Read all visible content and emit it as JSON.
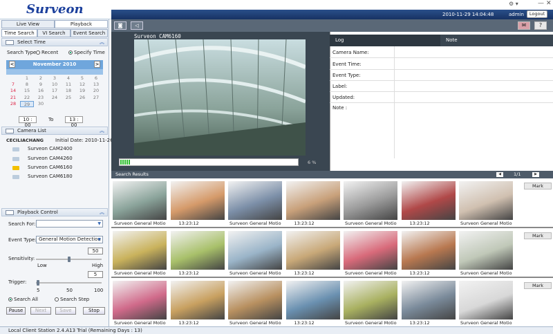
{
  "app": {
    "logo": "Surveon",
    "datetime": "2010-11-29 14:04:48",
    "user": "admin",
    "logout": "Logout",
    "window_controls": "⚙ ▾",
    "min": "—",
    "close": "✕"
  },
  "main_tabs": [
    "Live View",
    "Playback"
  ],
  "sub_tabs": [
    "Time Search",
    "VI Search",
    "Event Search"
  ],
  "select_time": {
    "title": "Select Time",
    "search_type_label": "Search Type:",
    "opt_recent": "Recent",
    "opt_specify": "Specify Time",
    "month": "November 2010",
    "prev": "<",
    "next": ">",
    "weeks": [
      [
        "",
        "1",
        "2",
        "3",
        "4",
        "5",
        "6"
      ],
      [
        "7",
        "8",
        "9",
        "10",
        "11",
        "12",
        "13"
      ],
      [
        "14",
        "15",
        "16",
        "17",
        "18",
        "19",
        "20"
      ],
      [
        "21",
        "22",
        "23",
        "24",
        "25",
        "26",
        "27"
      ],
      [
        "28",
        "29",
        "30",
        "",
        "",
        "",
        ""
      ]
    ],
    "from_time": "10 : 00",
    "to_label": "To",
    "to_time": "13 : 00"
  },
  "camera_list": {
    "title": "Camera List",
    "group": "CECILIACHANG",
    "initial_date": "Initial Date: 2010-11-26",
    "cameras": [
      "Surveon CAM2400",
      "Surveon CAM4260",
      "Surveon CAM6160",
      "Surveon CAM6180"
    ]
  },
  "playback_control": {
    "title": "Playback Control",
    "search_for_label": "Search For:",
    "search_for_value": "",
    "event_type_label": "Event Type:",
    "event_type_value": "General Motion Detection",
    "sensitivity_label": "Sensitivity:",
    "sens_value": "50",
    "low": "Low",
    "high": "High",
    "sens_step": "5",
    "trigger_label": "Trigger:",
    "trig_min": "5",
    "trig_mid": "50",
    "trig_max": "100",
    "search_all": "Search All",
    "search_step": "Search Step",
    "buttons": [
      "Pause",
      "Next",
      "Save",
      "Stop"
    ]
  },
  "viewer": {
    "camera_label": "Surveon CAM6160",
    "progress_pct": "6 %",
    "progress_fraction": 0.06
  },
  "info": {
    "tab_log": "Log",
    "tab_note": "Note",
    "fields": [
      "Camera Name:",
      "Event Time:",
      "Event Type:",
      "Label:",
      "Updated:",
      "Note :"
    ]
  },
  "results": {
    "title": "Search Results",
    "page": "1/1",
    "mark": "Mark",
    "cap_cam": "Surveon",
    "cap_event": "General Motio",
    "cap_time": "13:23:12"
  },
  "status": "Local Client Station 2.4.A13 Trial (Remaining Days : 13)",
  "colors": {
    "header_blue": "#1b3f9c",
    "dark_panel": "#3a4651",
    "accent": "#6fa6dc"
  }
}
